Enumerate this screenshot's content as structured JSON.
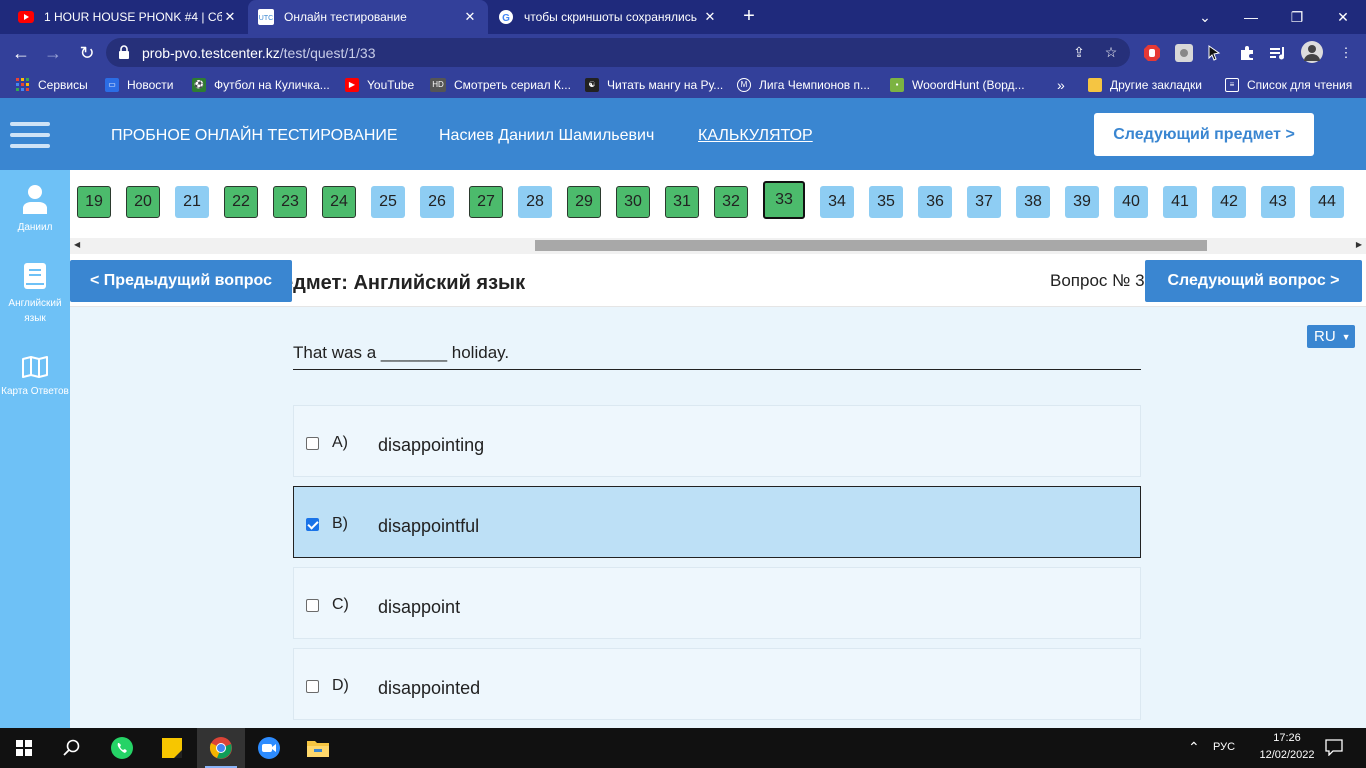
{
  "browser": {
    "tabs": [
      {
        "title": "1 HOUR HOUSE PHONK #4 | Сбо",
        "icon": "youtube-icon",
        "active": false
      },
      {
        "title": "Онлайн тестирование",
        "icon": "utc-icon",
        "active": true
      },
      {
        "title": "чтобы скриншоты сохранялись",
        "icon": "google-icon",
        "active": false
      }
    ],
    "url_domain": "prob-pvo.testcenter.kz",
    "url_path": "/test/quest/1/33",
    "bookmarks": [
      {
        "label": "Сервисы",
        "icon": "apps-icon"
      },
      {
        "label": "Новости",
        "icon": "news-icon"
      },
      {
        "label": "Футбол на Куличка...",
        "icon": "football-icon"
      },
      {
        "label": "YouTube",
        "icon": "youtube-icon"
      },
      {
        "label": "Смотреть сериал К...",
        "icon": "hd-icon"
      },
      {
        "label": "Читать мангу на Ру...",
        "icon": "manga-icon"
      },
      {
        "label": "Лига Чемпионов п...",
        "icon": "m-icon"
      },
      {
        "label": "WooordHunt (Ворд...",
        "icon": "wooordhunt-icon"
      }
    ],
    "bookmarks_more": "»",
    "other_bookmarks": "Другие закладки",
    "reading_list": "Список для чтения"
  },
  "header": {
    "title": "ПРОБНОЕ ОНЛАЙН ТЕСТИРОВАНИЕ",
    "user_name": "Насиев Даниил Шамильевич",
    "calculator": "КАЛЬКУЛЯТОР",
    "next_subject": "Следующий предмет >"
  },
  "sidebar": {
    "user": "Даниил",
    "subject": "Английский язык",
    "answers_map": "Карта Ответов"
  },
  "navigator": {
    "questions": [
      {
        "n": "19",
        "state": "answered"
      },
      {
        "n": "20",
        "state": "answered"
      },
      {
        "n": "21",
        "state": "unanswered"
      },
      {
        "n": "22",
        "state": "answered"
      },
      {
        "n": "23",
        "state": "answered"
      },
      {
        "n": "24",
        "state": "answered"
      },
      {
        "n": "25",
        "state": "unanswered"
      },
      {
        "n": "26",
        "state": "unanswered"
      },
      {
        "n": "27",
        "state": "answered"
      },
      {
        "n": "28",
        "state": "unanswered"
      },
      {
        "n": "29",
        "state": "answered"
      },
      {
        "n": "30",
        "state": "answered"
      },
      {
        "n": "31",
        "state": "answered"
      },
      {
        "n": "32",
        "state": "answered"
      },
      {
        "n": "33",
        "state": "current"
      },
      {
        "n": "34",
        "state": "unanswered"
      },
      {
        "n": "35",
        "state": "unanswered"
      },
      {
        "n": "36",
        "state": "unanswered"
      },
      {
        "n": "37",
        "state": "unanswered"
      },
      {
        "n": "38",
        "state": "unanswered"
      },
      {
        "n": "39",
        "state": "unanswered"
      },
      {
        "n": "40",
        "state": "unanswered"
      },
      {
        "n": "41",
        "state": "unanswered"
      },
      {
        "n": "42",
        "state": "unanswered"
      },
      {
        "n": "43",
        "state": "unanswered"
      },
      {
        "n": "44",
        "state": "unanswered"
      }
    ]
  },
  "subject_bar": {
    "subject_title": "едмет: Английский язык",
    "question_number": "Вопрос № 3",
    "prev_question": "< Предыдущий вопрос",
    "next_question": "Следующий вопрос >"
  },
  "question": {
    "language": "RU",
    "text": "That was a _______ holiday.",
    "options": [
      {
        "letter": "A)",
        "text": "disappointing",
        "selected": false
      },
      {
        "letter": "B)",
        "text": "disappointful",
        "selected": true
      },
      {
        "letter": "C)",
        "text": "disappoint",
        "selected": false
      },
      {
        "letter": "D)",
        "text": "disappointed",
        "selected": false
      }
    ]
  },
  "taskbar": {
    "language": "РУС",
    "time": "17:26",
    "date": "12/02/2022"
  },
  "colors": {
    "header_blue": "#3a86d1",
    "sidebar_blue": "#6ec1f6",
    "answered_green": "#4cbb6c",
    "unanswered_blue": "#8ecdf3",
    "selected_option": "#bde0f6"
  }
}
